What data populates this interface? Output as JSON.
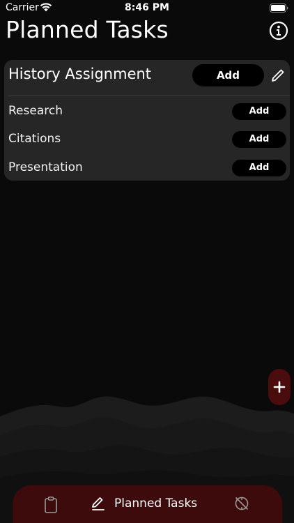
{
  "status_bar": {
    "carrier": "Carrier",
    "time": "8:46 PM",
    "icons": [
      "wifi-icon",
      "battery-icon"
    ]
  },
  "header": {
    "title": "Planned Tasks",
    "info_icon": "info-circle-icon"
  },
  "task_card": {
    "title": "History Assignment",
    "add_label": "Add",
    "edit_icon": "pencil-icon",
    "subtasks": [
      {
        "label": "Research",
        "add_label": "Add"
      },
      {
        "label": "Citations",
        "add_label": "Add"
      },
      {
        "label": "Presentation",
        "add_label": "Add"
      }
    ]
  },
  "fab": {
    "icon": "plus-icon"
  },
  "tab_bar": {
    "tabs": [
      {
        "icon": "clipboard-icon",
        "label": ""
      },
      {
        "icon": "pencil-line-icon",
        "label": "Planned Tasks",
        "selected": true
      },
      {
        "icon": "stats-icon",
        "label": ""
      }
    ]
  },
  "colors": {
    "background": "#0a0a0a",
    "card": "#262626",
    "button": "#000000",
    "accent": "#3d0b0b"
  }
}
